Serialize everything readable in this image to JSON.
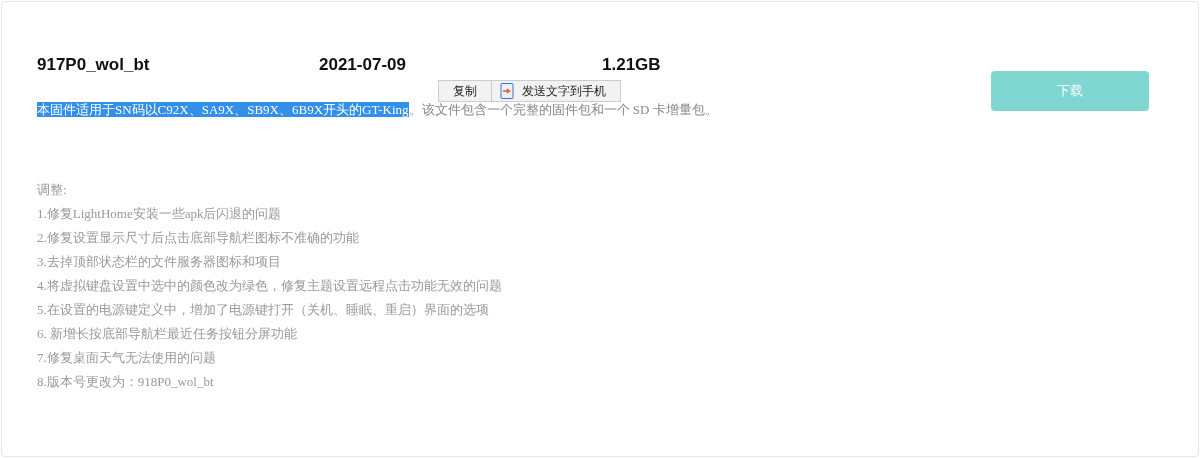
{
  "file": {
    "name": "917P0_wol_bt",
    "date": "2021-07-09",
    "size": "1.21GB"
  },
  "description": [
    {
      "text": "本固件适用于SN码以C92X、SA9X、SB9X、6B9X开头的GT-King",
      "selected": true
    },
    {
      "text": "。该文件包含一个完整的固件包和一个 SD 卡增量包。",
      "selected": false
    }
  ],
  "context_menu": {
    "items": [
      {
        "label": "复制",
        "kind": "text"
      },
      {
        "label": "发送文字到手机",
        "kind": "icon"
      }
    ]
  },
  "download_button": {
    "label": "下载"
  },
  "changes": {
    "heading": "调整:",
    "items": [
      "1.修复LightHome安装一些apk后闪退的问题",
      "2.修复设置显示尺寸后点击底部导航栏图标不准确的功能",
      "3.去掉顶部状态栏的文件服务器图标和项目",
      "4.将虚拟键盘设置中选中的颜色改为绿色，修复主题设置远程点击功能无效的问题",
      "5.在设置的电源键定义中，增加了电源键打开（关机、睡眠、重启）界面的选项",
      "6. 新增长按底部导航栏最近任务按钮分屏功能",
      "7.修复桌面天气无法使用的问题",
      "8.版本号更改为：918P0_wol_bt"
    ]
  }
}
